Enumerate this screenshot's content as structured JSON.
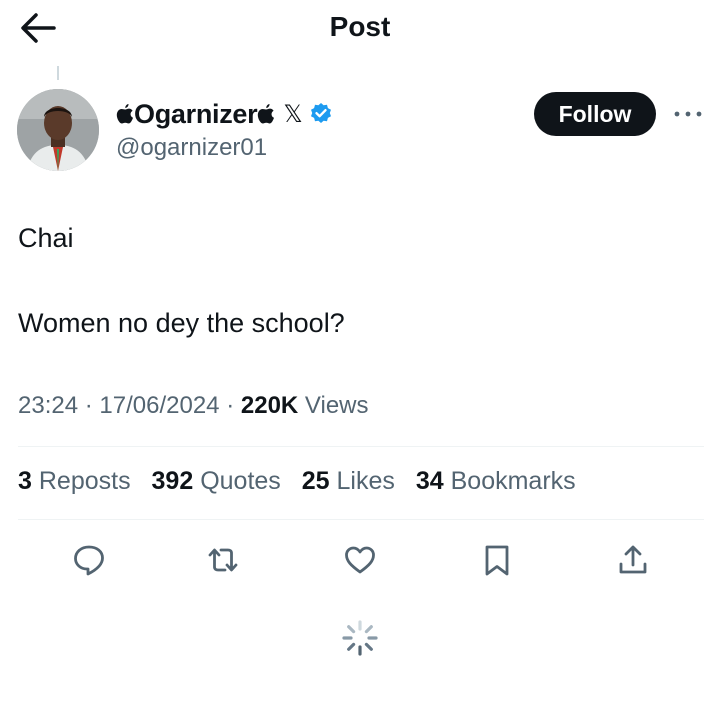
{
  "header": {
    "title": "Post",
    "back_icon": "arrow-left-icon"
  },
  "author": {
    "display_name": "Ogarnizer",
    "badge_x": "𝕏",
    "handle": "@ogarnizer01",
    "follow_label": "Follow",
    "verified_color": "#1d9bf0"
  },
  "post": {
    "line1": "Chai",
    "line2": "Women no dey the school?",
    "time": "23:24",
    "date": "17/06/2024",
    "views_count": "220K",
    "views_label": "Views"
  },
  "stats": {
    "reposts_count": "3",
    "reposts_label": "Reposts",
    "quotes_count": "392",
    "quotes_label": "Quotes",
    "likes_count": "25",
    "likes_label": "Likes",
    "bookmarks_count": "34",
    "bookmarks_label": "Bookmarks"
  },
  "actions": [
    "reply-icon",
    "repost-icon",
    "like-icon",
    "bookmark-icon",
    "share-icon"
  ]
}
